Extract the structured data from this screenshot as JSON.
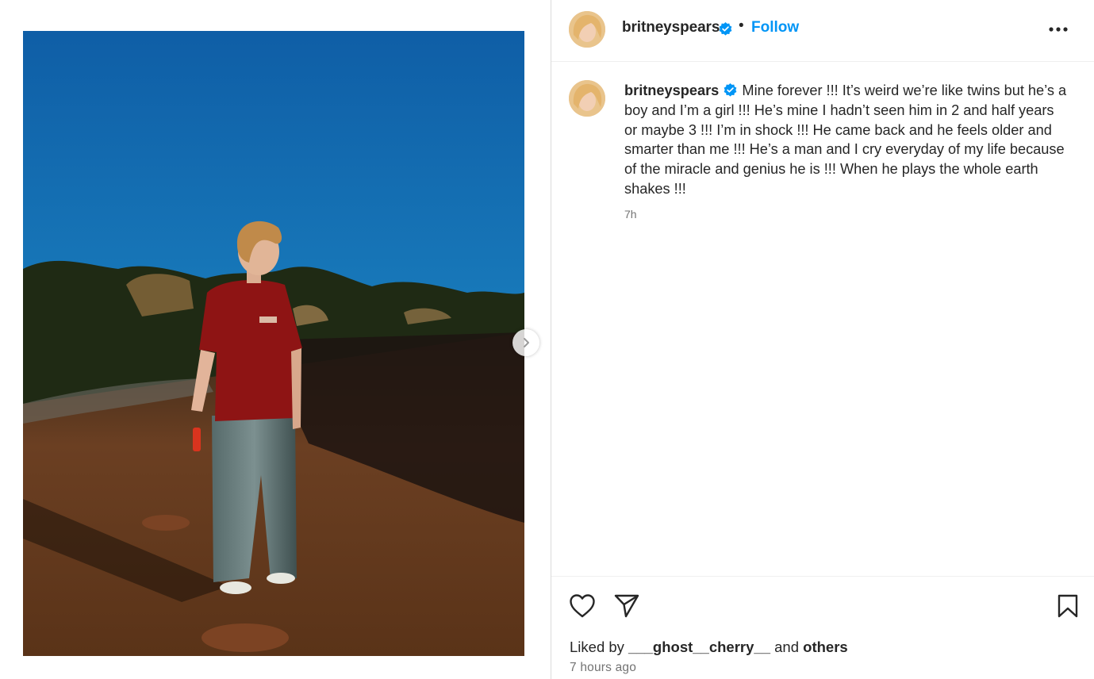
{
  "post": {
    "username": "britneyspears",
    "verified": true,
    "follow_label": "Follow",
    "separator": "•",
    "more_label": "...",
    "caption": {
      "username": "britneyspears",
      "text": "Mine forever !!! It’s weird we’re like twins but he’s a boy and I’m a girl !!! He’s mine I hadn’t seen him in 2 and half years or maybe 3 !!! I’m in shock !!! He came back and he feels older and smarter than me !!! He’s a man and I cry everyday of my life because of the miracle and genius he is !!! When he plays the whole earth shakes !!!",
      "relative_time": "7h"
    },
    "liked_by": {
      "prefix": "Liked by",
      "user": "___ghost__cherry__",
      "conjunction": "and",
      "others": "others"
    },
    "timestamp": "7 hours ago"
  },
  "icons": {
    "verified": "verified-badge-icon",
    "more": "more-options-icon",
    "like": "heart-icon",
    "share": "send-icon",
    "save": "bookmark-icon",
    "next": "chevron-right-icon"
  },
  "colors": {
    "follow": "#0095f6",
    "verified": "#0095f6",
    "text": "#262626",
    "secondary_text": "#737373",
    "sky": "#1b78b8",
    "shirt": "#8e1414"
  }
}
